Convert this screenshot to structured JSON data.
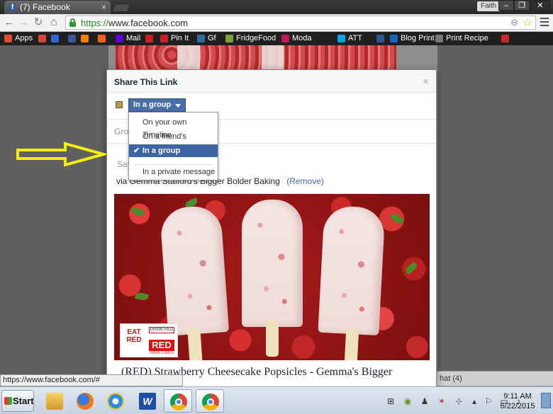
{
  "browser": {
    "tab_title": "(7) Facebook",
    "tab_favicon": "f",
    "profile_name": "Faith",
    "url_scheme": "https://",
    "url_host": "www.facebook.com",
    "bookmarks": [
      {
        "label": "Apps",
        "icon": "apps-grid-icon",
        "color": "#e34c26"
      },
      {
        "label": "",
        "icon": "gmail-icon",
        "color": "#d44638"
      },
      {
        "label": "",
        "icon": "calendar-icon",
        "color": "#3367d6"
      },
      {
        "label": "",
        "icon": "facebook-icon",
        "color": "#3b5998"
      },
      {
        "label": "",
        "icon": "blogger-icon",
        "color": "#f57d00"
      },
      {
        "label": "",
        "icon": "etsy-icon",
        "color": "#f1641e"
      },
      {
        "label": "Mail",
        "icon": "yahoo-mail-icon",
        "color": "#5f01d1"
      },
      {
        "label": "",
        "icon": "pinterest-icon",
        "color": "#cb2027"
      },
      {
        "label": "Pin It",
        "icon": "pin-it-icon",
        "color": "#cb2027"
      },
      {
        "label": "Gf",
        "icon": "gf-icon",
        "color": "#2d6da3"
      },
      {
        "label": "FridgeFood",
        "icon": "fridgefood-icon",
        "color": "#7aa33a"
      },
      {
        "label": "Moda",
        "icon": "moda-icon",
        "color": "#c2185b"
      },
      {
        "label": "ATT",
        "icon": "att-icon",
        "color": "#00a8e0"
      },
      {
        "label": "",
        "icon": "p-icon",
        "color": "#2b5797"
      },
      {
        "label": "Blog Print",
        "icon": "blog-print-icon",
        "color": "#1565c0"
      },
      {
        "label": "Print Recipe",
        "icon": "print-recipe-icon",
        "color": "#777777"
      },
      {
        "label": "",
        "icon": "food-icon",
        "color": "#c62828"
      }
    ]
  },
  "dialog": {
    "title": "Share This Link",
    "audience_button": "In a group",
    "group_placeholder": "Grou",
    "say_placeholder": "Say",
    "via_text": "via Gemma Stafford's Bigger Bolder Baking",
    "remove_label": "(Remove)",
    "story_title": "(RED) Strawberry Cheesecake Popsicles - Gemma's Bigger",
    "logo": {
      "eat": "EAT RED",
      "drink": "DRINK RED",
      "red": "RED",
      "save": "SAVE LIVES"
    }
  },
  "dropdown": {
    "items": [
      {
        "label": "On your own Timeline",
        "selected": false
      },
      {
        "label": "On a friend's Timeline",
        "selected": false
      },
      {
        "label": "In a group",
        "selected": true
      },
      {
        "label": "In a private message",
        "selected": false
      }
    ]
  },
  "chat": {
    "label": "hat (4)"
  },
  "status_url": "https://www.facebook.com/#",
  "taskbar": {
    "start_label": "Start",
    "clock_time": "9:11 AM",
    "clock_date": "6/22/2015"
  },
  "colors": {
    "facebook_blue": "#4a6ea9",
    "dropdown_selected": "#3f64a5",
    "annotation_arrow": "#f4f000"
  }
}
